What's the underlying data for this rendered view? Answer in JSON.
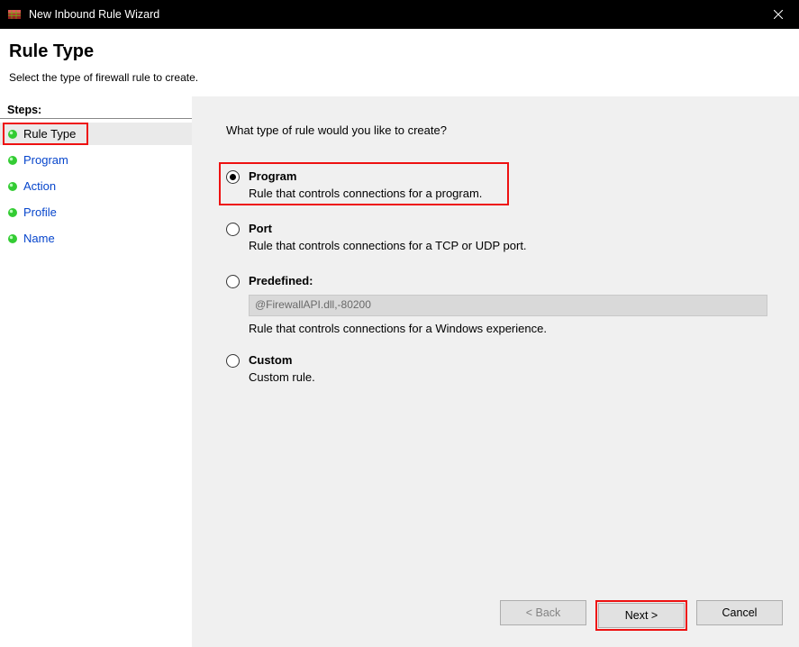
{
  "window": {
    "title": "New Inbound Rule Wizard"
  },
  "header": {
    "title": "Rule Type",
    "subtitle": "Select the type of firewall rule to create."
  },
  "sidebar": {
    "steps_label": "Steps:",
    "items": [
      {
        "label": "Rule Type",
        "current": true
      },
      {
        "label": "Program",
        "current": false
      },
      {
        "label": "Action",
        "current": false
      },
      {
        "label": "Profile",
        "current": false
      },
      {
        "label": "Name",
        "current": false
      }
    ]
  },
  "main": {
    "question": "What type of rule would you like to create?",
    "options": {
      "program": {
        "title": "Program",
        "desc": "Rule that controls connections for a program."
      },
      "port": {
        "title": "Port",
        "desc": "Rule that controls connections for a TCP or UDP port."
      },
      "predefined": {
        "title": "Predefined:",
        "value": "@FirewallAPI.dll,-80200",
        "desc": "Rule that controls connections for a Windows experience."
      },
      "custom": {
        "title": "Custom",
        "desc": "Custom rule."
      }
    }
  },
  "buttons": {
    "back": "< Back",
    "next": "Next >",
    "cancel": "Cancel"
  }
}
